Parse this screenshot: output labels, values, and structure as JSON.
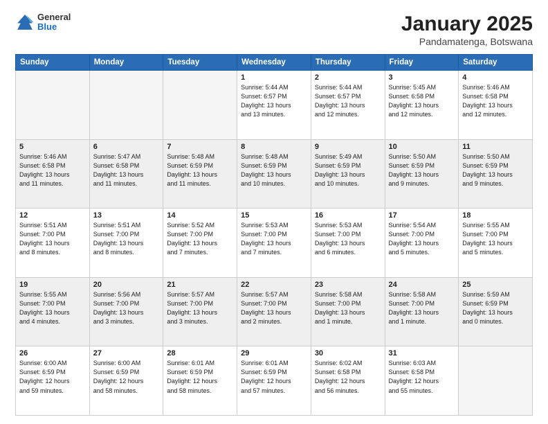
{
  "header": {
    "logo": {
      "general": "General",
      "blue": "Blue"
    },
    "title": "January 2025",
    "subtitle": "Pandamatenga, Botswana"
  },
  "days_of_week": [
    "Sunday",
    "Monday",
    "Tuesday",
    "Wednesday",
    "Thursday",
    "Friday",
    "Saturday"
  ],
  "weeks": [
    [
      {
        "day": "",
        "info": ""
      },
      {
        "day": "",
        "info": ""
      },
      {
        "day": "",
        "info": ""
      },
      {
        "day": "1",
        "info": "Sunrise: 5:44 AM\nSunset: 6:57 PM\nDaylight: 13 hours\nand 13 minutes."
      },
      {
        "day": "2",
        "info": "Sunrise: 5:44 AM\nSunset: 6:57 PM\nDaylight: 13 hours\nand 12 minutes."
      },
      {
        "day": "3",
        "info": "Sunrise: 5:45 AM\nSunset: 6:58 PM\nDaylight: 13 hours\nand 12 minutes."
      },
      {
        "day": "4",
        "info": "Sunrise: 5:46 AM\nSunset: 6:58 PM\nDaylight: 13 hours\nand 12 minutes."
      }
    ],
    [
      {
        "day": "5",
        "info": "Sunrise: 5:46 AM\nSunset: 6:58 PM\nDaylight: 13 hours\nand 11 minutes."
      },
      {
        "day": "6",
        "info": "Sunrise: 5:47 AM\nSunset: 6:58 PM\nDaylight: 13 hours\nand 11 minutes."
      },
      {
        "day": "7",
        "info": "Sunrise: 5:48 AM\nSunset: 6:59 PM\nDaylight: 13 hours\nand 11 minutes."
      },
      {
        "day": "8",
        "info": "Sunrise: 5:48 AM\nSunset: 6:59 PM\nDaylight: 13 hours\nand 10 minutes."
      },
      {
        "day": "9",
        "info": "Sunrise: 5:49 AM\nSunset: 6:59 PM\nDaylight: 13 hours\nand 10 minutes."
      },
      {
        "day": "10",
        "info": "Sunrise: 5:50 AM\nSunset: 6:59 PM\nDaylight: 13 hours\nand 9 minutes."
      },
      {
        "day": "11",
        "info": "Sunrise: 5:50 AM\nSunset: 6:59 PM\nDaylight: 13 hours\nand 9 minutes."
      }
    ],
    [
      {
        "day": "12",
        "info": "Sunrise: 5:51 AM\nSunset: 7:00 PM\nDaylight: 13 hours\nand 8 minutes."
      },
      {
        "day": "13",
        "info": "Sunrise: 5:51 AM\nSunset: 7:00 PM\nDaylight: 13 hours\nand 8 minutes."
      },
      {
        "day": "14",
        "info": "Sunrise: 5:52 AM\nSunset: 7:00 PM\nDaylight: 13 hours\nand 7 minutes."
      },
      {
        "day": "15",
        "info": "Sunrise: 5:53 AM\nSunset: 7:00 PM\nDaylight: 13 hours\nand 7 minutes."
      },
      {
        "day": "16",
        "info": "Sunrise: 5:53 AM\nSunset: 7:00 PM\nDaylight: 13 hours\nand 6 minutes."
      },
      {
        "day": "17",
        "info": "Sunrise: 5:54 AM\nSunset: 7:00 PM\nDaylight: 13 hours\nand 5 minutes."
      },
      {
        "day": "18",
        "info": "Sunrise: 5:55 AM\nSunset: 7:00 PM\nDaylight: 13 hours\nand 5 minutes."
      }
    ],
    [
      {
        "day": "19",
        "info": "Sunrise: 5:55 AM\nSunset: 7:00 PM\nDaylight: 13 hours\nand 4 minutes."
      },
      {
        "day": "20",
        "info": "Sunrise: 5:56 AM\nSunset: 7:00 PM\nDaylight: 13 hours\nand 3 minutes."
      },
      {
        "day": "21",
        "info": "Sunrise: 5:57 AM\nSunset: 7:00 PM\nDaylight: 13 hours\nand 3 minutes."
      },
      {
        "day": "22",
        "info": "Sunrise: 5:57 AM\nSunset: 7:00 PM\nDaylight: 13 hours\nand 2 minutes."
      },
      {
        "day": "23",
        "info": "Sunrise: 5:58 AM\nSunset: 7:00 PM\nDaylight: 13 hours\nand 1 minute."
      },
      {
        "day": "24",
        "info": "Sunrise: 5:58 AM\nSunset: 7:00 PM\nDaylight: 13 hours\nand 1 minute."
      },
      {
        "day": "25",
        "info": "Sunrise: 5:59 AM\nSunset: 6:59 PM\nDaylight: 13 hours\nand 0 minutes."
      }
    ],
    [
      {
        "day": "26",
        "info": "Sunrise: 6:00 AM\nSunset: 6:59 PM\nDaylight: 12 hours\nand 59 minutes."
      },
      {
        "day": "27",
        "info": "Sunrise: 6:00 AM\nSunset: 6:59 PM\nDaylight: 12 hours\nand 58 minutes."
      },
      {
        "day": "28",
        "info": "Sunrise: 6:01 AM\nSunset: 6:59 PM\nDaylight: 12 hours\nand 58 minutes."
      },
      {
        "day": "29",
        "info": "Sunrise: 6:01 AM\nSunset: 6:59 PM\nDaylight: 12 hours\nand 57 minutes."
      },
      {
        "day": "30",
        "info": "Sunrise: 6:02 AM\nSunset: 6:58 PM\nDaylight: 12 hours\nand 56 minutes."
      },
      {
        "day": "31",
        "info": "Sunrise: 6:03 AM\nSunset: 6:58 PM\nDaylight: 12 hours\nand 55 minutes."
      },
      {
        "day": "",
        "info": ""
      }
    ]
  ]
}
